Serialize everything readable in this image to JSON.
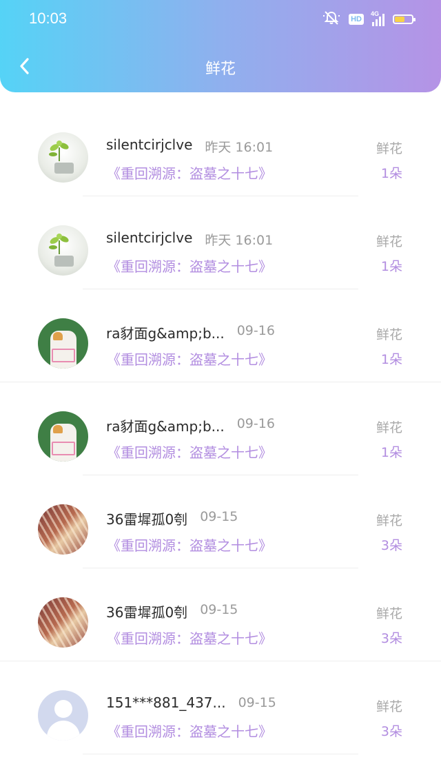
{
  "status_bar": {
    "time": "10:03",
    "hd": "HD",
    "network": "4G"
  },
  "header": {
    "title": "鲜花"
  },
  "items": [
    {
      "avatar": "plant",
      "username": "silentcirjclve",
      "time": "昨天 16:01",
      "book": "《重回溯源：盗墓之十七》",
      "gift_label": "鲜花",
      "count": "1朵",
      "divider": "short"
    },
    {
      "avatar": "plant",
      "username": "silentcirjclve",
      "time": "昨天 16:01",
      "book": "《重回溯源：盗墓之十七》",
      "gift_label": "鲜花",
      "count": "1朵",
      "divider": "short"
    },
    {
      "avatar": "cat",
      "username": "ra豺面g&amp;b...",
      "time": "09-16",
      "book": "《重回溯源：盗墓之十七》",
      "gift_label": "鲜花",
      "count": "1朵",
      "divider": "full"
    },
    {
      "avatar": "cat",
      "username": "ra豺面g&amp;b...",
      "time": "09-16",
      "book": "《重回溯源：盗墓之十七》",
      "gift_label": "鲜花",
      "count": "1朵",
      "divider": "short"
    },
    {
      "avatar": "piano",
      "username": "36雷墀孤0刳",
      "time": "09-15",
      "book": "《重回溯源：盗墓之十七》",
      "gift_label": "鲜花",
      "count": "3朵",
      "divider": "short"
    },
    {
      "avatar": "piano",
      "username": "36雷墀孤0刳",
      "time": "09-15",
      "book": "《重回溯源：盗墓之十七》",
      "gift_label": "鲜花",
      "count": "3朵",
      "divider": "full"
    },
    {
      "avatar": "default",
      "username": "151***881_437...",
      "time": "09-15",
      "book": "《重回溯源：盗墓之十七》",
      "gift_label": "鲜花",
      "count": "3朵",
      "divider": "short"
    }
  ]
}
